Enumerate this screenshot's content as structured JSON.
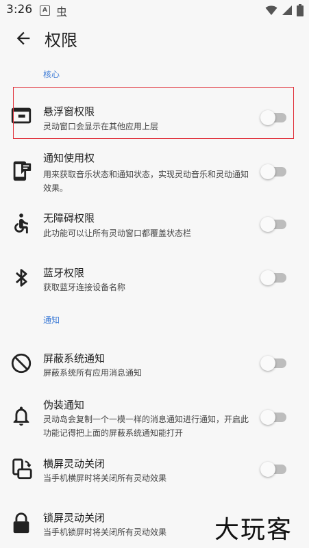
{
  "status_bar": {
    "time": "3:26",
    "a_icon_text": "A",
    "bug_icon": "虫"
  },
  "app_bar": {
    "title": "权限"
  },
  "sections": {
    "core": "核心",
    "notify": "通知"
  },
  "items": [
    {
      "title": "悬浮窗权限",
      "summary": "灵动窗口会显示在其他应用上层",
      "icon": "window-icon",
      "enabled": false
    },
    {
      "title": "通知使用权",
      "summary": "用来获取音乐状态和通知状态，实现灵动音乐和灵动通知效果。",
      "icon": "notification-phone-icon",
      "enabled": false
    },
    {
      "title": "无障碍权限",
      "summary": "此功能可以让所有灵动窗口都覆盖状态栏",
      "icon": "accessibility-icon",
      "enabled": false
    },
    {
      "title": "蓝牙权限",
      "summary": "获取蓝牙连接设备名称",
      "icon": "bluetooth-icon",
      "enabled": false
    },
    {
      "title": "屏蔽系统通知",
      "summary": "屏蔽系统所有应用消息通知",
      "icon": "block-icon",
      "enabled": false
    },
    {
      "title": "伪装通知",
      "summary": "灵动岛会复制一个一模一样的消息通知进行通知，开启此功能记得把上面的屏蔽系统通知能打开",
      "icon": "bell-icon",
      "enabled": false
    },
    {
      "title": "横屏灵动关闭",
      "summary": "当手机横屏时将关闭所有灵动效果",
      "icon": "screen-rotation-icon",
      "enabled": false
    },
    {
      "title": "锁屏灵动关闭",
      "summary": "当手机锁屏时将关闭所有灵动效果",
      "icon": "lock-icon",
      "enabled": false
    }
  ],
  "watermark": "大玩客",
  "colors": {
    "accent": "#3f7cd6",
    "highlight": "#e0303a",
    "background": "#f7f7f7"
  }
}
